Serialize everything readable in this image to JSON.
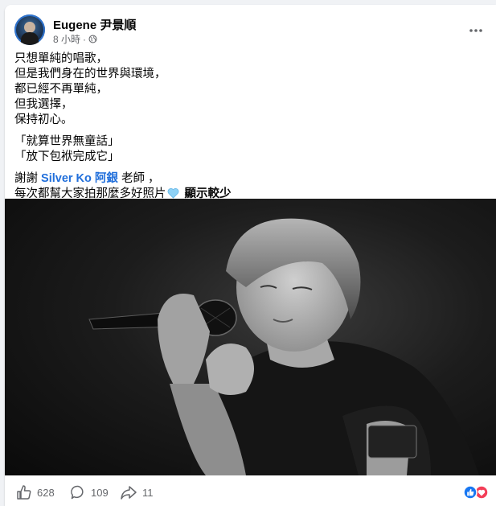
{
  "post": {
    "author": "Eugene 尹景順",
    "time": "8 小時",
    "separator": "·",
    "privacy_icon": "globe-icon",
    "more_icon": "more-dots-icon",
    "body": {
      "para1": [
        "只想單純的唱歌，",
        "但是我們身在的世界與環境，",
        "都已經不再單純，",
        "但我選擇，",
        "保持初心。"
      ],
      "para2": [
        "「就算世界無童話」",
        "「放下包袱完成它」"
      ],
      "thanks_prefix": "謝謝 ",
      "mention_1": "Silver Ko",
      "mention_2": "阿銀",
      "thanks_suffix": " 老師 ，",
      "last_line": "每次都幫大家拍那麼多好照片",
      "heart_icon": "light-blue-heart-emoji",
      "see_less": "顯示較少"
    },
    "photo": {
      "description_icon": "singer-photo"
    }
  },
  "footer": {
    "likes": "628",
    "comments": "109",
    "shares": "11",
    "like_icon": "thumbs-up-icon",
    "comment_icon": "comment-bubble-icon",
    "share_icon": "share-arrow-icon",
    "reaction_icons": [
      "like-reaction-icon",
      "love-reaction-icon"
    ]
  },
  "colors": {
    "link": "#216fdb",
    "muted": "#65676b",
    "like_blue": "#1877f2",
    "love_red": "#f33e58",
    "heart_light_blue": "#8ed1f5"
  }
}
